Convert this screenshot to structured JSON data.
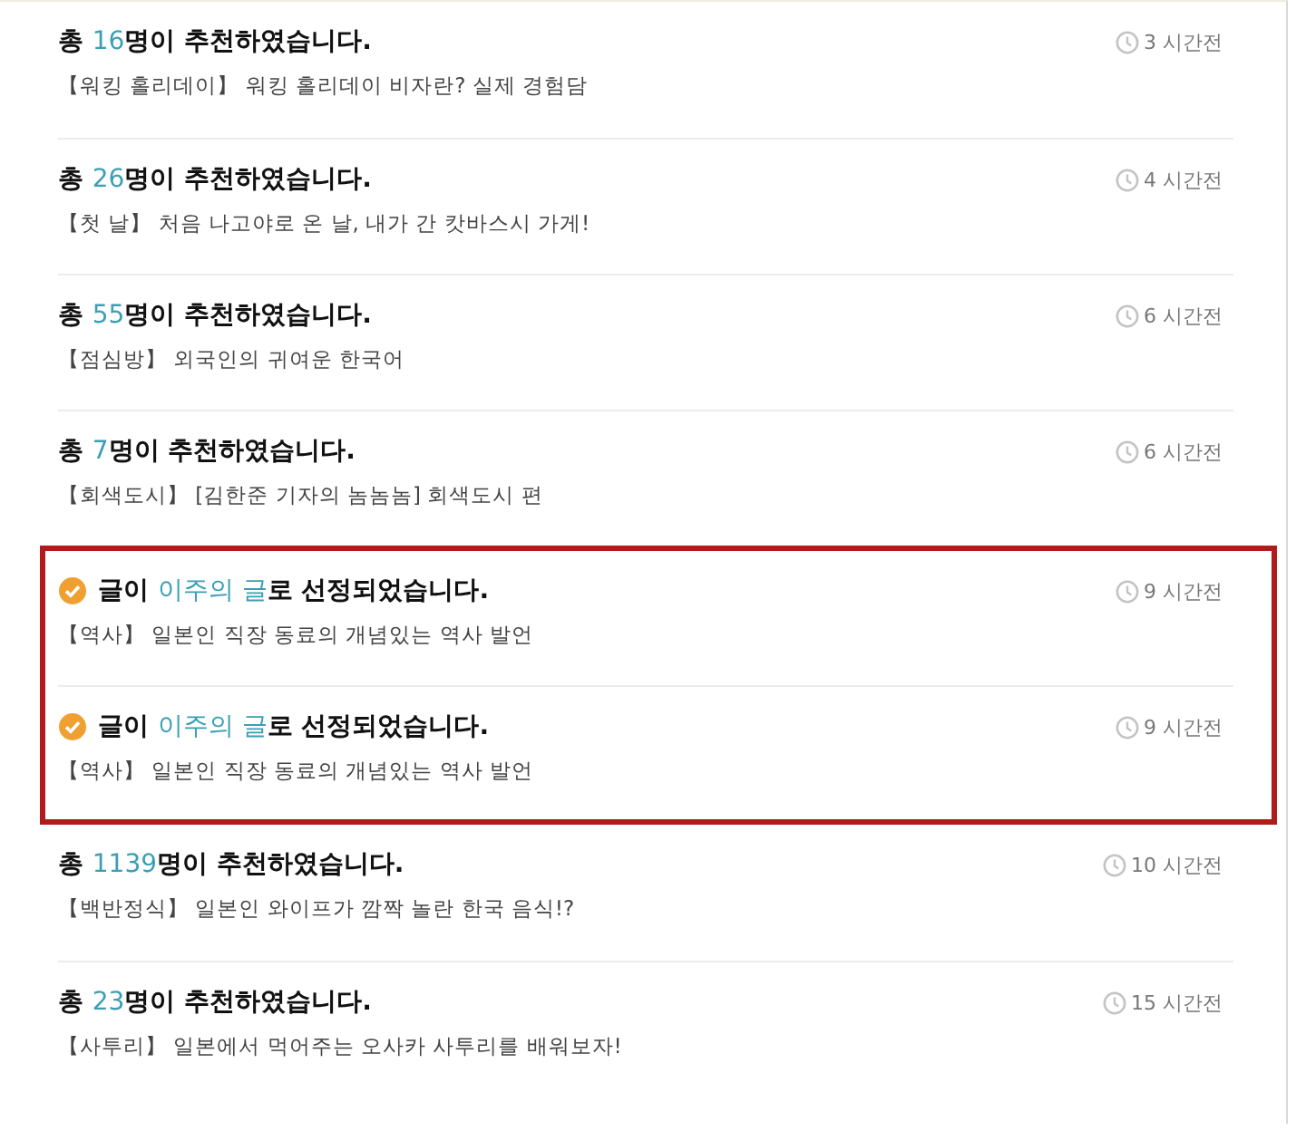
{
  "groups": [
    {
      "highlighted": false,
      "items": [
        {
          "kind": "recommend",
          "heading": {
            "before": "총 ",
            "accent": "16",
            "after": "명이 추천하였습니다."
          },
          "title": "【워킹 홀리데이】 워킹 홀리데이 비자란? 실제 경험담",
          "time": "3 시간전"
        },
        {
          "kind": "recommend",
          "heading": {
            "before": "총 ",
            "accent": "26",
            "after": "명이 추천하였습니다."
          },
          "title": "【첫 날】 처음 나고야로 온 날, 내가 간 캇바스시 가게!",
          "time": "4 시간전"
        },
        {
          "kind": "recommend",
          "heading": {
            "before": "총 ",
            "accent": "55",
            "after": "명이 추천하였습니다."
          },
          "title": "【점심방】 외국인의 귀여운 한국어",
          "time": "6 시간전"
        },
        {
          "kind": "recommend",
          "heading": {
            "before": "총 ",
            "accent": "7",
            "after": "명이 추천하였습니다."
          },
          "title": "【회색도시】 [김한준 기자의 놈놈놈] 회색도시 편",
          "time": "6 시간전"
        }
      ]
    },
    {
      "highlighted": true,
      "items": [
        {
          "kind": "selected",
          "heading": {
            "before": "글이 ",
            "accent": "이주의 글",
            "after": "로 선정되었습니다."
          },
          "title": "【역사】 일본인 직장 동료의 개념있는 역사 발언",
          "time": "9 시간전"
        },
        {
          "kind": "selected",
          "heading": {
            "before": "글이 ",
            "accent": "이주의 글",
            "after": "로 선정되었습니다."
          },
          "title": "【역사】 일본인 직장 동료의 개념있는 역사 발언",
          "time": "9 시간전"
        }
      ]
    },
    {
      "highlighted": false,
      "items": [
        {
          "kind": "recommend",
          "heading": {
            "before": "총 ",
            "accent": "1139",
            "after": "명이 추천하였습니다."
          },
          "title": "【백반정식】 일본인 와이프가 깜짝 놀란 한국 음식!?",
          "time": "10 시간전"
        },
        {
          "kind": "recommend",
          "heading": {
            "before": "총 ",
            "accent": "23",
            "after": "명이 추천하였습니다."
          },
          "title": "【사투리】 일본에서 먹어주는 오사카 사투리를 배워보자!",
          "time": "15 시간전"
        }
      ]
    }
  ]
}
